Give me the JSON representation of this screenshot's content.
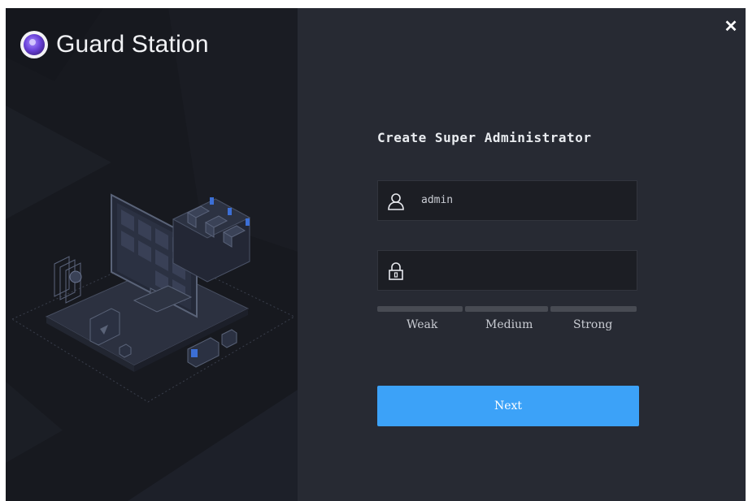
{
  "window": {
    "app_name": "Guard Station",
    "close_icon": "close-icon",
    "close_glyph": "✕"
  },
  "form": {
    "title": "Create Super Administrator",
    "username": {
      "icon": "user-icon",
      "value": "admin"
    },
    "password": {
      "icon": "lock-icon",
      "value": "",
      "placeholder": ""
    },
    "strength": {
      "labels": [
        "Weak",
        "Medium",
        "Strong"
      ],
      "level": 0
    },
    "next_label": "Next"
  },
  "colors": {
    "accent": "#3ca2f8",
    "left_panel": "#17191f",
    "right_panel": "#272a33",
    "input_bg": "#1c1e24",
    "strength_bar": "#484b53"
  }
}
